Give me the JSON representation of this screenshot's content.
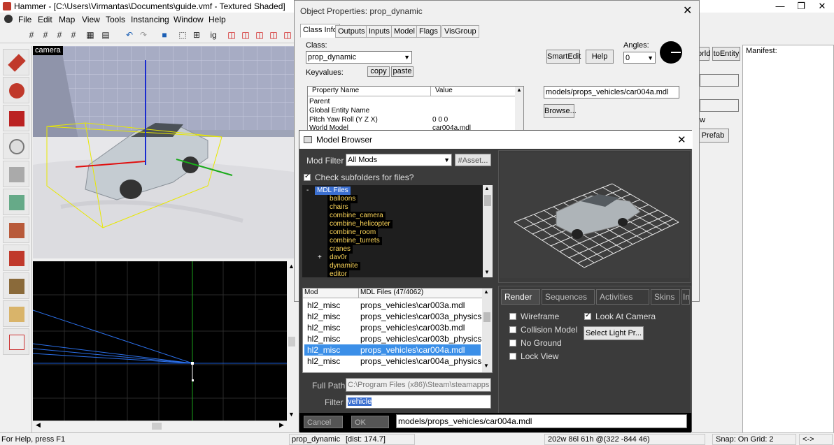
{
  "window": {
    "title": "Hammer - [C:\\Users\\Virmantas\\Documents\\guide.vmf - Textured Shaded]",
    "minimize": "—",
    "restore": "❐",
    "close": "✕"
  },
  "menu": [
    "File",
    "Edit",
    "Map",
    "View",
    "Tools",
    "Instancing",
    "Window",
    "Help"
  ],
  "viewport3d": {
    "label": "camera"
  },
  "right_panel": {
    "world_button": "orld",
    "to_entity_button": "toEntity",
    "manifest_label": "Manifest:",
    "prefab_button": "Prefab",
    "w_label": "w"
  },
  "status": {
    "help": "For Help, press F1",
    "selection": "prop_dynamic",
    "dist": "[dist: 174.7]",
    "size": "202w 86l 61h @(322 -844 46)",
    "snap": "Snap: On Grid: 2",
    "arrows": "<->"
  },
  "object_properties": {
    "title": "Object Properties: prop_dynamic",
    "tabs": [
      "Class Info",
      "Outputs",
      "Inputs",
      "Model",
      "Flags",
      "VisGroup"
    ],
    "active_tab": "Class Info",
    "class_label": "Class:",
    "class_value": "prop_dynamic",
    "keyvalues_label": "Keyvalues:",
    "copy_button": "copy",
    "paste_button": "paste",
    "smartedit_button": "SmartEdit",
    "help_button": "Help",
    "angles_label": "Angles:",
    "angles_value": "0",
    "table_headers": [
      "Property Name",
      "Value"
    ],
    "rows": [
      {
        "name": "Parent",
        "value": ""
      },
      {
        "name": "Global Entity Name",
        "value": ""
      },
      {
        "name": "Pitch Yaw Roll (Y Z X)",
        "value": "0 0 0"
      },
      {
        "name": "World Model",
        "value": "car004a.mdl"
      }
    ],
    "model_path": "models/props_vehicles/car004a.mdl",
    "browse_button": "Browse..."
  },
  "model_browser": {
    "title": "Model Browser",
    "mod_filter_label": "Mod Filter",
    "mod_filter_value": "All Mods",
    "asset_button": "#Asset...",
    "check_subfolders_label": "Check subfolders for files?",
    "check_subfolders_checked": true,
    "tree_root": "MDL Files",
    "tree_items": [
      "balloons",
      "chairs",
      "combine_camera",
      "combine_helicopter",
      "combine_room",
      "combine_turrets",
      "cranes",
      "dav0r",
      "dynamite",
      "editor"
    ],
    "list_headers": [
      "Mod",
      "MDL Files (47/4062)"
    ],
    "list_rows": [
      {
        "mod": "hl2_misc",
        "file": "props_vehicles\\car003a.mdl",
        "selected": false
      },
      {
        "mod": "hl2_misc",
        "file": "props_vehicles\\car003a_physics..",
        "selected": false
      },
      {
        "mod": "hl2_misc",
        "file": "props_vehicles\\car003b.mdl",
        "selected": false
      },
      {
        "mod": "hl2_misc",
        "file": "props_vehicles\\car003b_physics..",
        "selected": false
      },
      {
        "mod": "hl2_misc",
        "file": "props_vehicles\\car004a.mdl",
        "selected": true
      },
      {
        "mod": "hl2_misc",
        "file": "props_vehicles\\car004a_physics..",
        "selected": false
      }
    ],
    "full_path_label": "Full Path",
    "full_path_value": "C:\\Program Files (x86)\\Steam\\steamapps",
    "filter_label": "Filter",
    "filter_value": "vehicle",
    "render_tabs": [
      "Render",
      "Sequences",
      "Activities",
      "Skins",
      "In"
    ],
    "active_render_tab": "Render",
    "render_options": [
      {
        "label": "Wireframe",
        "checked": false
      },
      {
        "label": "Collision Model",
        "checked": false
      },
      {
        "label": "No Ground",
        "checked": false
      },
      {
        "label": "Lock View",
        "checked": false
      }
    ],
    "look_at_camera_label": "Look At Camera",
    "look_at_camera_checked": true,
    "select_light_button": "Select Light Pr...",
    "cancel_button": "Cancel",
    "ok_button": "OK",
    "selected_model": "models/props_vehicles/car004a.mdl"
  }
}
